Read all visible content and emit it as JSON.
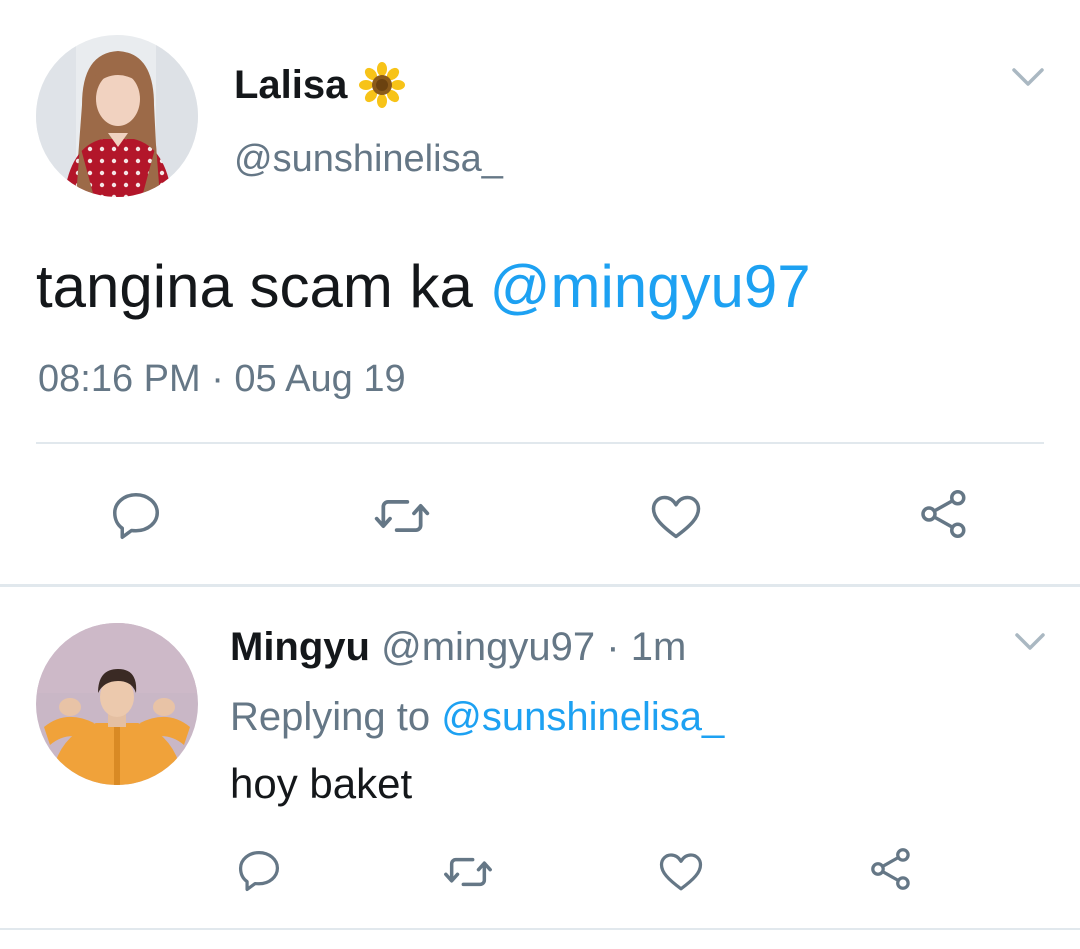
{
  "main_tweet": {
    "author_name": "Lalisa",
    "author_emoji": "sunflower-emoji",
    "author_handle": "@sunshinelisa_",
    "text": "tangina scam ka ",
    "mention": "@mingyu97",
    "timestamp": "08:16 PM · 05 Aug 19",
    "actions": [
      "reply-icon",
      "retweet-icon",
      "like-icon",
      "share-icon"
    ]
  },
  "reply_tweet": {
    "author_name": "Mingyu",
    "author_handle": "@mingyu97",
    "separator": "·",
    "time": "1m",
    "replying_label": "Replying to ",
    "replying_to": "@sunshinelisa_",
    "text": "hoy baket",
    "actions": [
      "reply-icon",
      "retweet-icon",
      "like-icon",
      "share-icon"
    ]
  },
  "colors": {
    "text_primary": "#14171a",
    "text_secondary": "#657786",
    "link": "#1da1f2",
    "divider": "#e1e8ed",
    "icon": "#657786"
  }
}
